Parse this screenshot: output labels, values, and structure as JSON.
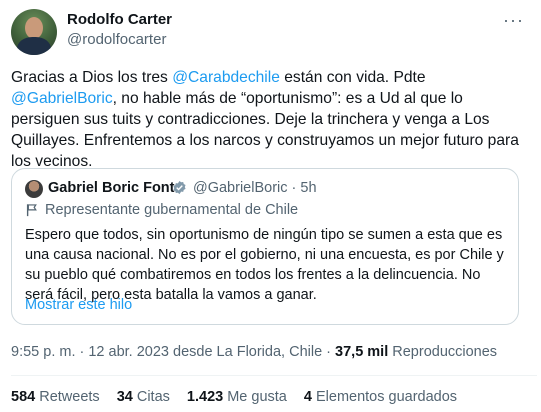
{
  "author": {
    "name": "Rodolfo Carter",
    "handle": "@rodolfocarter"
  },
  "more_icon": "ellipsis-icon",
  "tweet": {
    "p1": "Gracias a Dios los tres ",
    "mention1": "@Carabdechile",
    "p2": " están con vida. Pdte ",
    "mention2": "@GabrielBoric",
    "p3": ", no hable más de “oportunismo”: es a Ud al que lo persiguen sus tuits y contradicciones. Deje la trinchera y venga a Los Quillayes. Enfrentemos a los narcos y construyamos un mejor futuro para los vecinos."
  },
  "quote": {
    "name": "Gabriel Boric Font",
    "handle_time": "@GabrielBoric · 5h",
    "label": "Representante gubernamental de Chile",
    "text": "Espero que todos, sin oportunismo de ningún tipo se sumen a esta que es una causa nacional. No es por el gobierno, ni una encuesta, es por Chile y su pueblo qué combatiremos en todos los frentes a la delincuencia. No será fácil, pero esta batalla la vamos a ganar.",
    "show_thread": "Mostrar este hilo",
    "verified_color": "#829aab"
  },
  "meta": {
    "time_date": "9:55 p. m. · 12 abr. 2023 desde La Florida, Chile · ",
    "views": "37,5 mil",
    "views_label": " Reproducciones"
  },
  "stats": {
    "retweets": "584",
    "retweets_label": " Retweets",
    "quotes": "34",
    "quotes_label": " Citas",
    "likes": "1.423",
    "likes_label": " Me gusta",
    "bookmarks": "4",
    "bookmarks_label": " Elementos guardados"
  },
  "colors": {
    "link": "#1d9bf0",
    "secondary": "#536471",
    "border": "#cfd9de"
  }
}
